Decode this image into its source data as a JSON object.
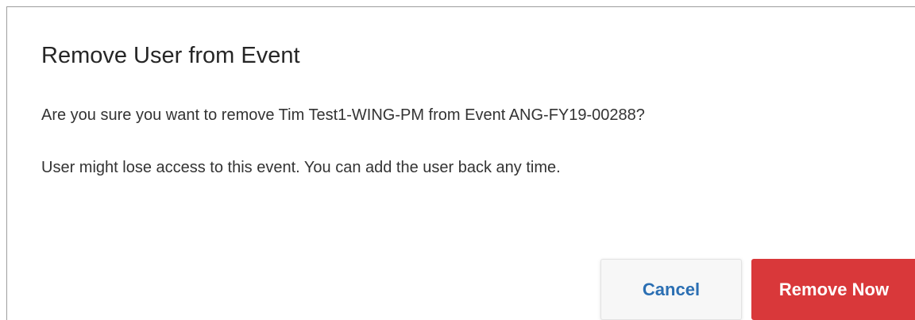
{
  "dialog": {
    "title": "Remove User from Event",
    "message": "Are you sure you want to remove Tim Test1-WING-PM from Event ANG-FY19-00288?",
    "warning": "User might lose access to this event. You can add the user back any time.",
    "cancel_label": "Cancel",
    "confirm_label": "Remove Now"
  },
  "colors": {
    "confirm_button_bg": "#d9383a",
    "cancel_text": "#2b6fb3"
  }
}
